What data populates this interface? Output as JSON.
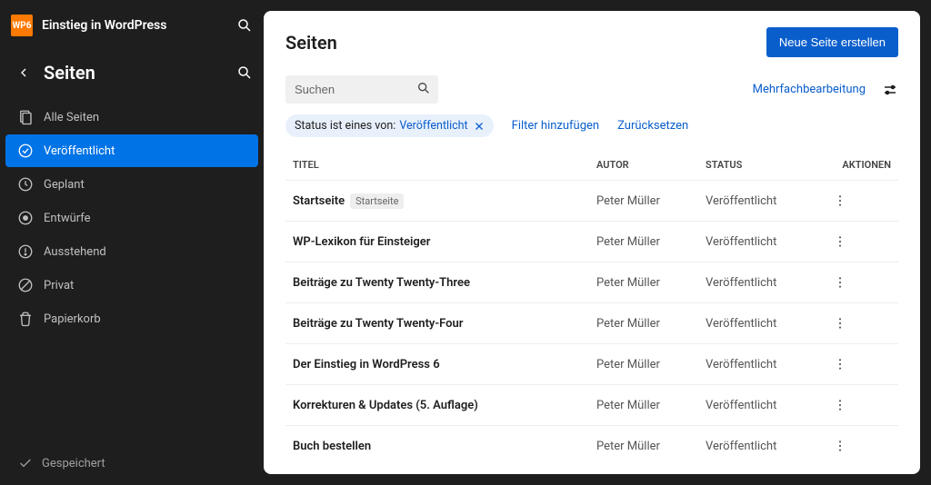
{
  "site": {
    "logo_text": "WP6",
    "title": "Einstieg in WordPress"
  },
  "section": {
    "title": "Seiten"
  },
  "nav": {
    "items": [
      {
        "label": "Alle Seiten",
        "icon": "pages"
      },
      {
        "label": "Veröffentlicht",
        "icon": "published",
        "active": true
      },
      {
        "label": "Geplant",
        "icon": "scheduled"
      },
      {
        "label": "Entwürfe",
        "icon": "drafts"
      },
      {
        "label": "Ausstehend",
        "icon": "pending"
      },
      {
        "label": "Privat",
        "icon": "private"
      },
      {
        "label": "Papierkorb",
        "icon": "trash"
      }
    ]
  },
  "saved_label": "Gespeichert",
  "main": {
    "title": "Seiten",
    "new_button": "Neue Seite erstellen",
    "search_placeholder": "Suchen",
    "bulk_edit": "Mehrfachbearbeitung",
    "filter_chip": {
      "label": "Status ist eines von:",
      "value": "Veröffentlicht"
    },
    "add_filter": "Filter hinzufügen",
    "reset": "Zurücksetzen",
    "columns": {
      "title": "TITEL",
      "author": "AUTOR",
      "status": "STATUS",
      "actions": "AKTIONEN"
    },
    "rows": [
      {
        "title": "Startseite",
        "badge": "Startseite",
        "author": "Peter Müller",
        "status": "Veröffentlicht"
      },
      {
        "title": "WP-Lexikon für Einsteiger",
        "author": "Peter Müller",
        "status": "Veröffentlicht"
      },
      {
        "title": "Beiträge zu Twenty Twenty-Three",
        "author": "Peter Müller",
        "status": "Veröffentlicht"
      },
      {
        "title": "Beiträge zu Twenty Twenty-Four",
        "author": "Peter Müller",
        "status": "Veröffentlicht"
      },
      {
        "title": "Der Einstieg in WordPress 6",
        "author": "Peter Müller",
        "status": "Veröffentlicht"
      },
      {
        "title": "Korrekturen & Updates (5. Auflage)",
        "author": "Peter Müller",
        "status": "Veröffentlicht"
      },
      {
        "title": "Buch bestellen",
        "author": "Peter Müller",
        "status": "Veröffentlicht"
      }
    ]
  }
}
